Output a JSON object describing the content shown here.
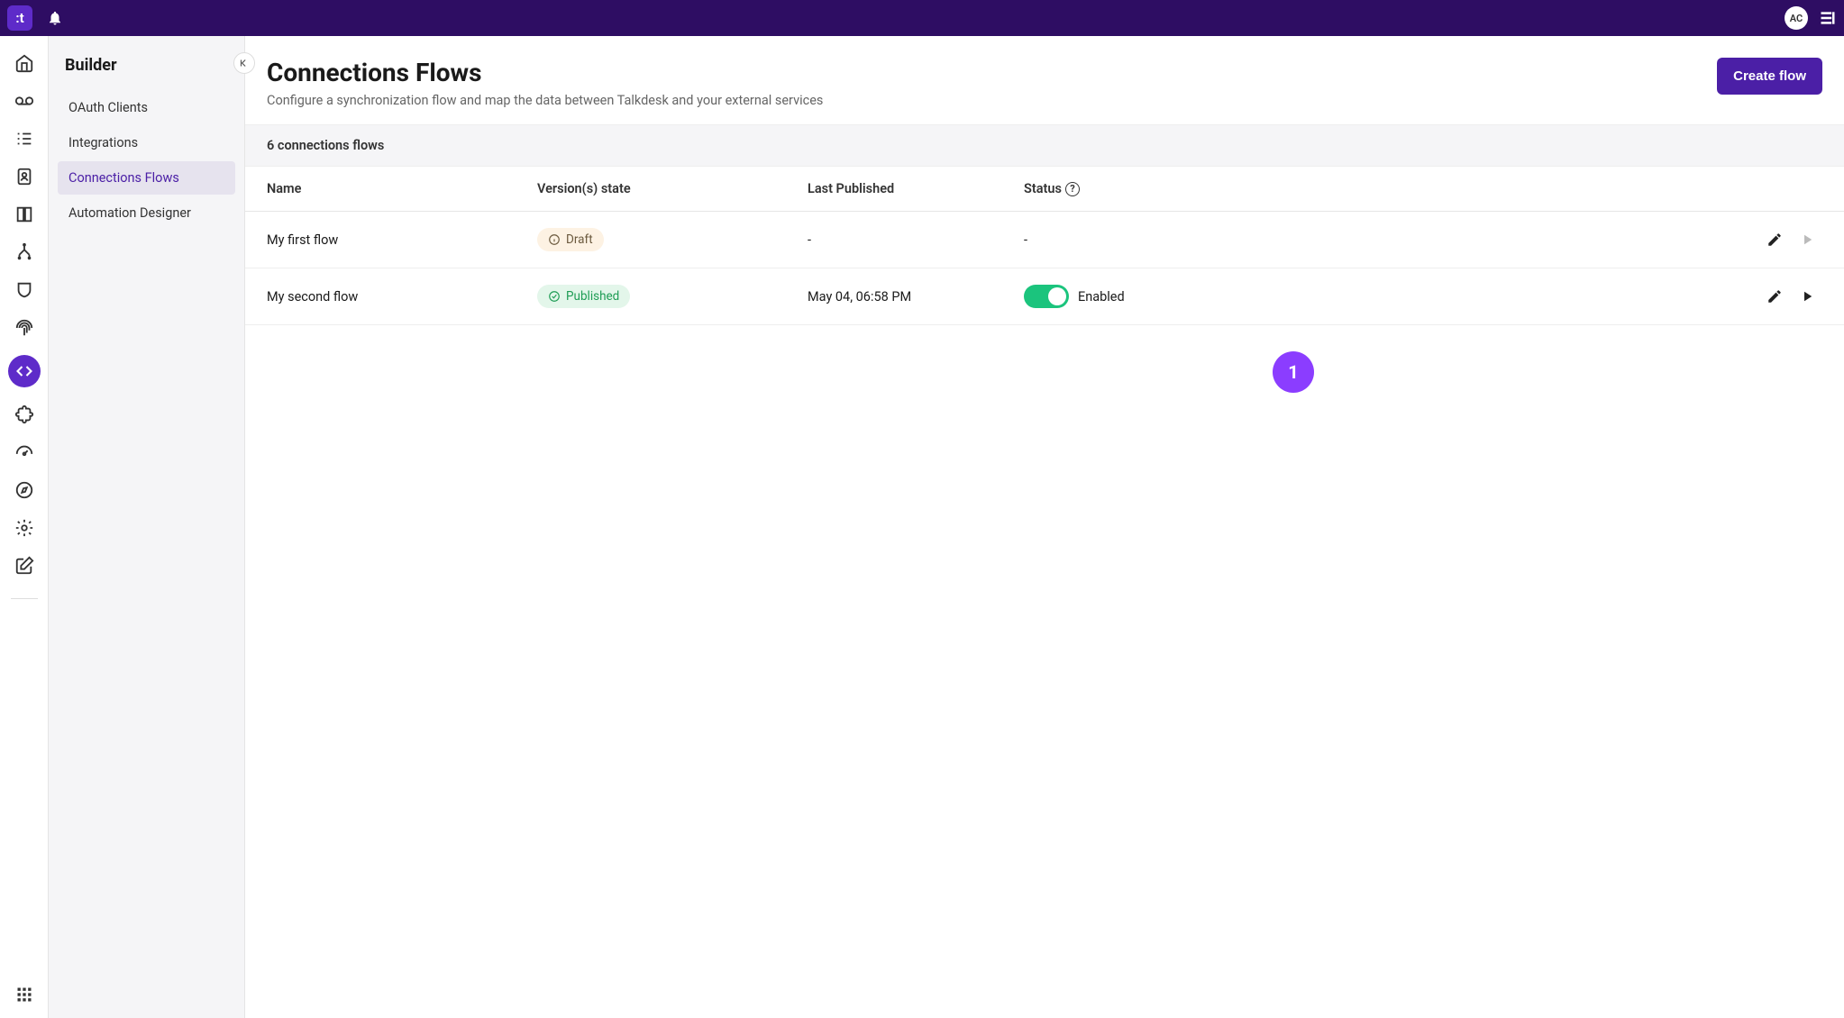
{
  "topbar": {
    "logo_text": ":t",
    "avatar_initials": "AC"
  },
  "sidebar": {
    "title": "Builder",
    "items": [
      {
        "label": "OAuth Clients",
        "active": false
      },
      {
        "label": "Integrations",
        "active": false
      },
      {
        "label": "Connections Flows",
        "active": true
      },
      {
        "label": "Automation Designer",
        "active": false
      }
    ]
  },
  "page": {
    "title": "Connections Flows",
    "subtitle": "Configure a synchronization flow and map the data between Talkdesk and your external services",
    "create_button": "Create flow",
    "count_text": "6 connections flows"
  },
  "table": {
    "headers": {
      "name": "Name",
      "version": "Version(s) state",
      "published": "Last Published",
      "status": "Status"
    },
    "rows": [
      {
        "name": "My first flow",
        "version_state": "Draft",
        "version_style": "draft",
        "last_published": "-",
        "status_text": "-",
        "has_toggle": false,
        "play_enabled": false
      },
      {
        "name": "My second flow",
        "version_state": "Published",
        "version_style": "published",
        "last_published": "May 04, 06:58 PM",
        "status_text": "Enabled",
        "has_toggle": true,
        "toggle_on": true,
        "play_enabled": true
      }
    ]
  },
  "callout": {
    "number": "1"
  }
}
